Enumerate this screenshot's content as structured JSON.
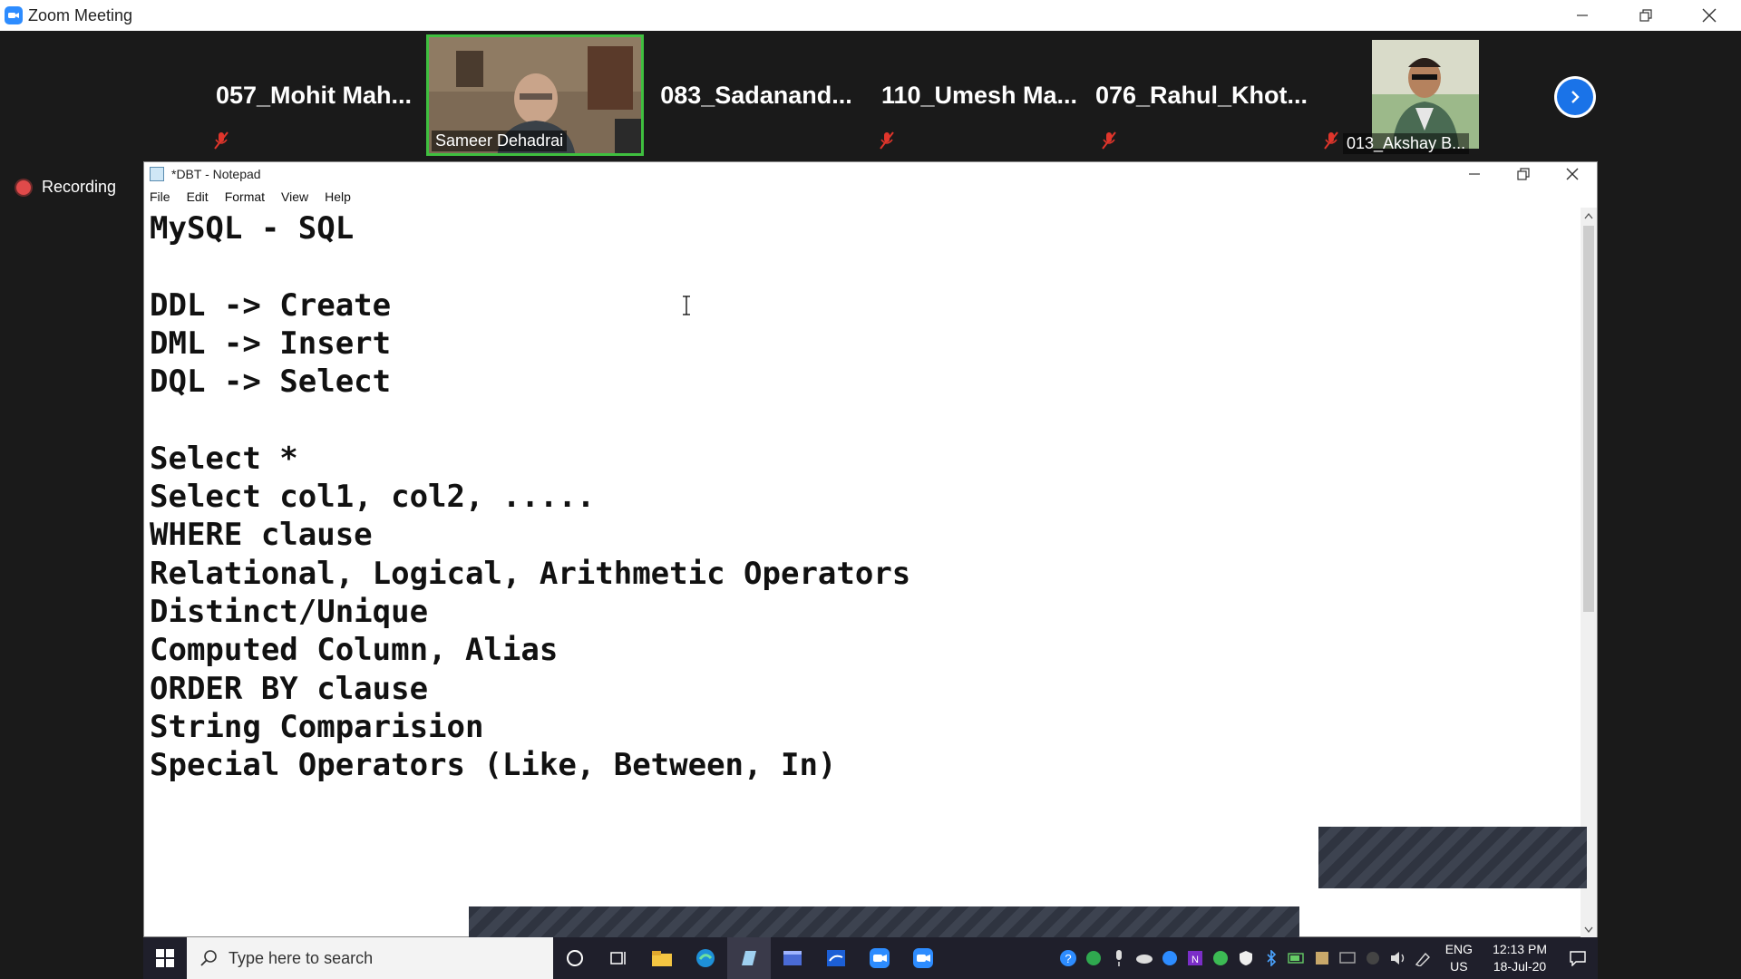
{
  "zoom": {
    "title": "Zoom Meeting",
    "recording_label": "Recording"
  },
  "participants": [
    {
      "name": "057_Mohit  Mah...",
      "muted": true
    },
    {
      "name": "Sameer Dehadrai",
      "video": true
    },
    {
      "name": "083_Sadanand...",
      "muted": false
    },
    {
      "name": "110_Umesh  Ma...",
      "muted": true
    },
    {
      "name": "076_Rahul_Khot...",
      "muted": true
    },
    {
      "name": "013_Akshay B...",
      "video": true,
      "muted": true
    }
  ],
  "notepad": {
    "title": "*DBT - Notepad",
    "menu": [
      "File",
      "Edit",
      "Format",
      "View",
      "Help"
    ],
    "content": "MySQL - SQL\n\nDDL -> Create\nDML -> Insert\nDQL -> Select\n\nSelect *\nSelect col1, col2, .....\nWHERE clause\nRelational, Logical, Arithmetic Operators\nDistinct/Unique\nComputed Column, Alias\nORDER BY clause\nString Comparision\nSpecial Operators (Like, Between, In)"
  },
  "taskbar": {
    "search_placeholder": "Type here to search",
    "lang_top": "ENG",
    "lang_bottom": "US",
    "time": "12:13 PM",
    "date": "18-Jul-20"
  },
  "colors": {
    "zoom_blue": "#2d8cff",
    "active_speaker_border": "#3fbf3f",
    "recording_red": "#e04a4a",
    "taskbar_bg": "#1f1f2b"
  }
}
